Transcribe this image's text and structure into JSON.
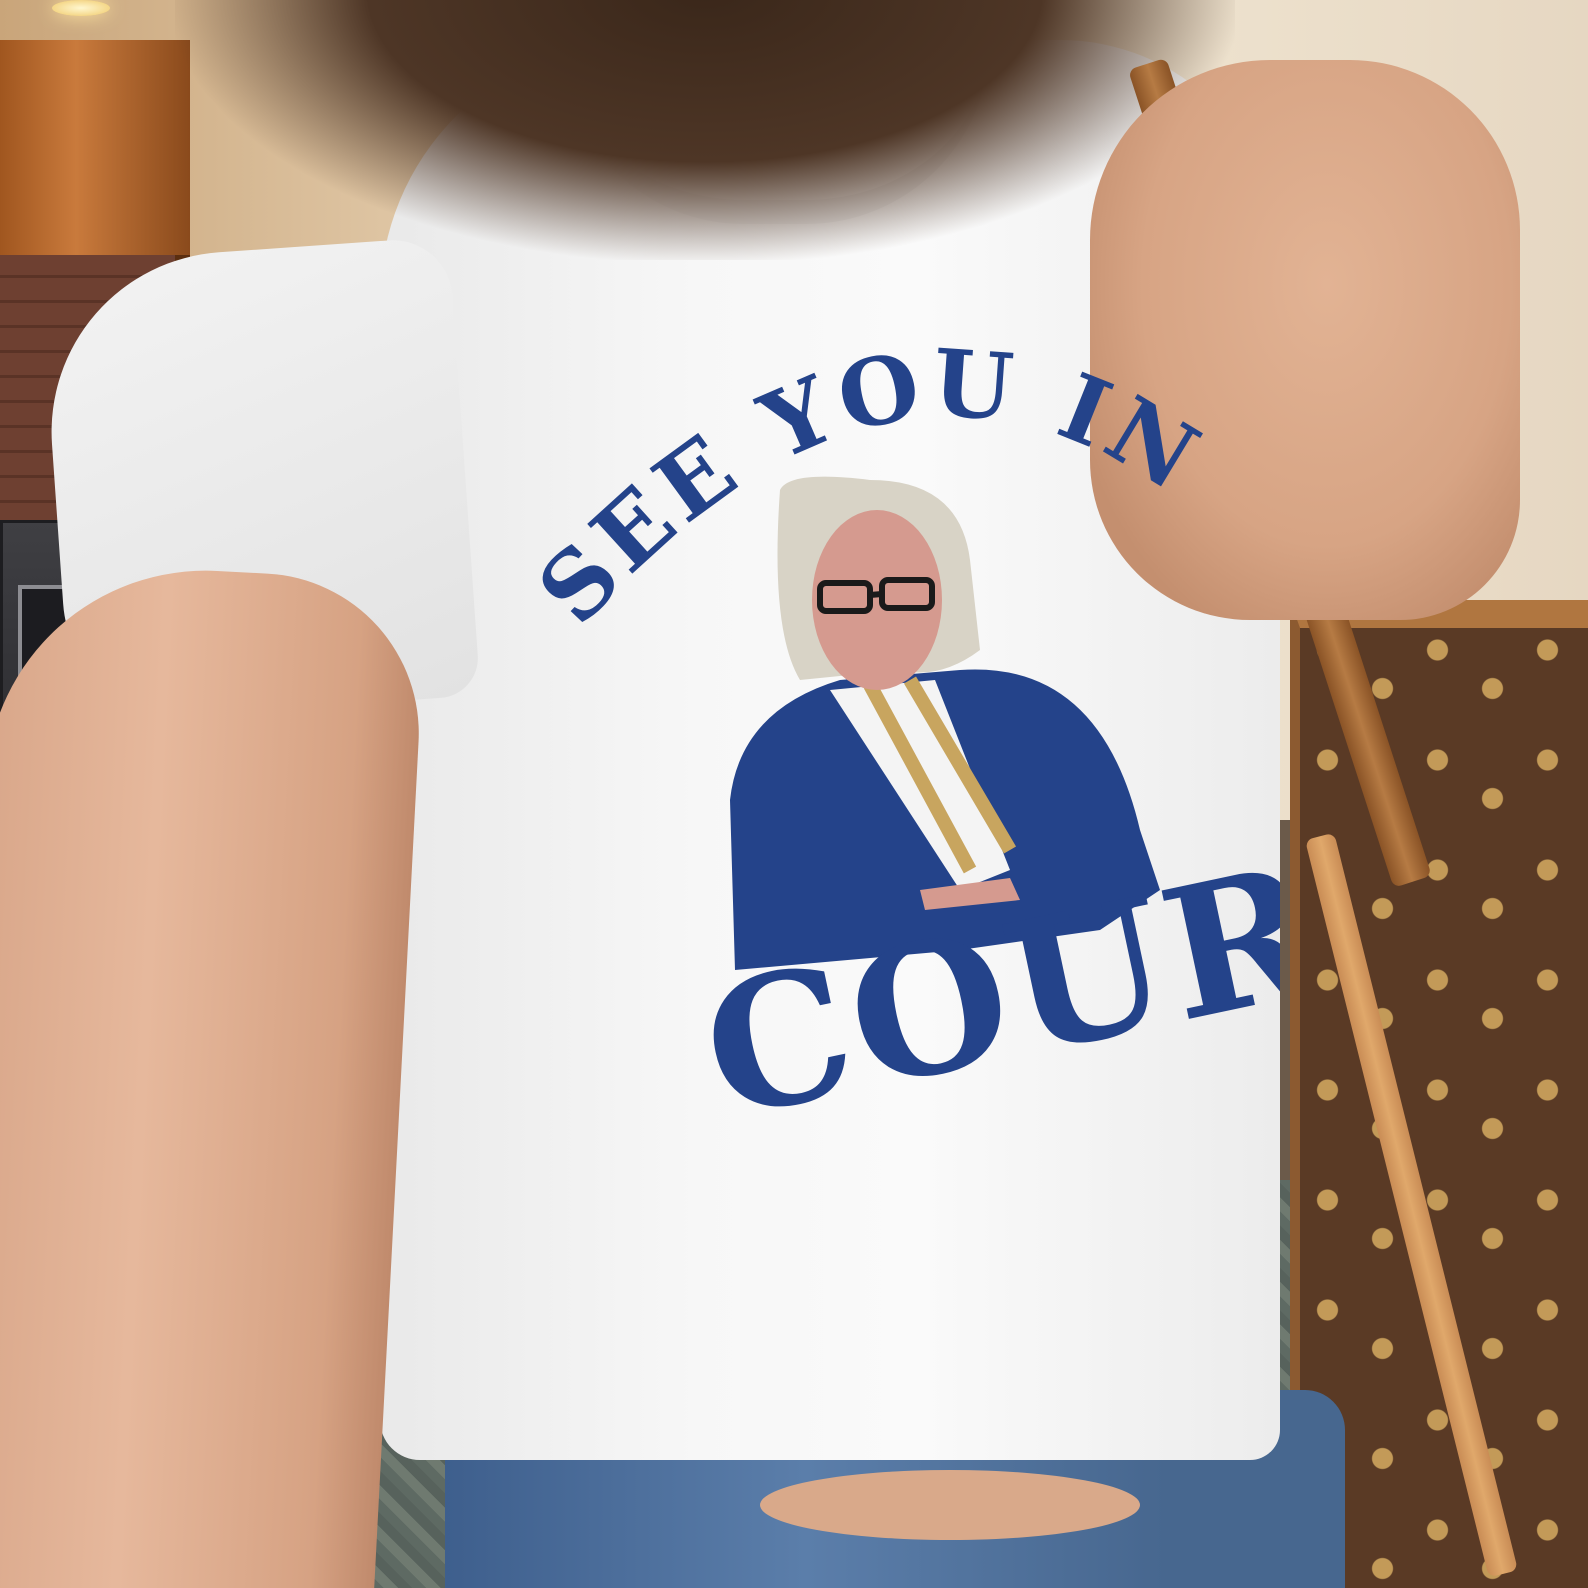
{
  "photo": {
    "subject": "person wearing printed t-shirt with shoulder bag",
    "shirt_print": {
      "line1": "SEE YOU IN",
      "line2": "COURT"
    }
  },
  "colors": {
    "print_blue": "#24438a",
    "hair_blonde": "#d8d3c6",
    "skin_pink": "#d59a8f",
    "stripe_gold": "#c8a55f",
    "shirt_white": "#f5f5f5"
  }
}
